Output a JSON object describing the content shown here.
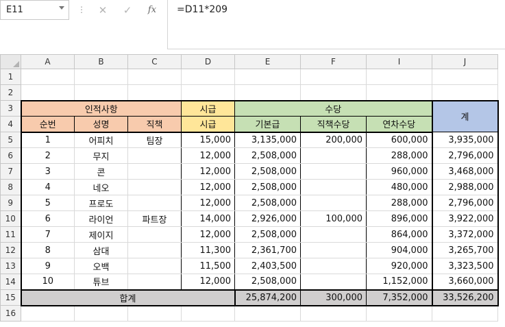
{
  "formula_bar": {
    "name_box": "E11",
    "cancel_icon": "cancel-x-icon",
    "enter_icon": "check-icon",
    "function_icon": "fx",
    "formula": "=D11*209"
  },
  "columns": [
    "A",
    "B",
    "C",
    "D",
    "E",
    "F",
    "I",
    "J"
  ],
  "rows": [
    "1",
    "2",
    "3",
    "4",
    "5",
    "6",
    "7",
    "8",
    "9",
    "10",
    "11",
    "12",
    "13",
    "14",
    "15",
    "16"
  ],
  "header": {
    "personnel": "인적사항",
    "hourly_top": "시급",
    "allowance": "수당",
    "total": "계",
    "no": "순번",
    "name": "성명",
    "position": "직책",
    "hourly": "시급",
    "base_pay": "기본급",
    "position_allowance": "직책수당",
    "leave_allowance": "연차수당"
  },
  "employees": [
    {
      "no": "1",
      "name": "어피치",
      "position": "팀장",
      "hourly": "15,000",
      "base": "3,135,000",
      "pos_allow": "200,000",
      "leave": "600,000",
      "total": "3,935,000"
    },
    {
      "no": "2",
      "name": "무지",
      "position": "",
      "hourly": "12,000",
      "base": "2,508,000",
      "pos_allow": "",
      "leave": "288,000",
      "total": "2,796,000"
    },
    {
      "no": "3",
      "name": "콘",
      "position": "",
      "hourly": "12,000",
      "base": "2,508,000",
      "pos_allow": "",
      "leave": "960,000",
      "total": "3,468,000"
    },
    {
      "no": "4",
      "name": "네오",
      "position": "",
      "hourly": "12,000",
      "base": "2,508,000",
      "pos_allow": "",
      "leave": "480,000",
      "total": "2,988,000"
    },
    {
      "no": "5",
      "name": "프로도",
      "position": "",
      "hourly": "12,000",
      "base": "2,508,000",
      "pos_allow": "",
      "leave": "288,000",
      "total": "2,796,000"
    },
    {
      "no": "6",
      "name": "라이언",
      "position": "파트장",
      "hourly": "14,000",
      "base": "2,926,000",
      "pos_allow": "100,000",
      "leave": "896,000",
      "total": "3,922,000"
    },
    {
      "no": "7",
      "name": "제이지",
      "position": "",
      "hourly": "12,000",
      "base": "2,508,000",
      "pos_allow": "",
      "leave": "864,000",
      "total": "3,372,000"
    },
    {
      "no": "8",
      "name": "삼대",
      "position": "",
      "hourly": "11,300",
      "base": "2,361,700",
      "pos_allow": "",
      "leave": "904,000",
      "total": "3,265,700"
    },
    {
      "no": "9",
      "name": "오백",
      "position": "",
      "hourly": "11,500",
      "base": "2,403,500",
      "pos_allow": "",
      "leave": "920,000",
      "total": "3,323,500"
    },
    {
      "no": "10",
      "name": "튜브",
      "position": "",
      "hourly": "12,000",
      "base": "2,508,000",
      "pos_allow": "",
      "leave": "1,152,000",
      "total": "3,660,000"
    }
  ],
  "totals": {
    "label": "합계",
    "base": "25,874,200",
    "pos_allow": "300,000",
    "leave": "7,352,000",
    "total": "33,526,200"
  },
  "colors": {
    "personnel_header": "#f8cbad",
    "hourly_header": "#ffe699",
    "allowance_header": "#c6e0b4",
    "total_header": "#b4c6e7",
    "sum_row": "#d0cece"
  }
}
